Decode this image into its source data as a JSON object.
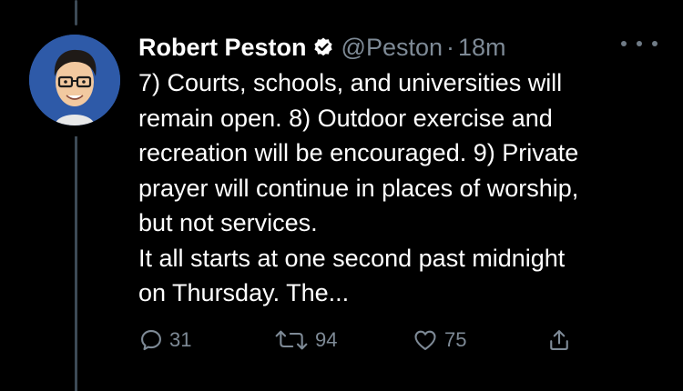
{
  "tweet": {
    "author_name": "Robert Peston",
    "handle": "@Peston",
    "separator": "·",
    "time": "18m",
    "body": "7) Courts, schools, and universities will\nremain open. 8) Outdoor exercise and\nrecreation will be encouraged. 9) Private\nprayer will continue in places of worship,\nbut not services.\nIt all starts at one second past midnight\non Thursday. The...",
    "verified": true
  },
  "actions": {
    "reply_count": "31",
    "retweet_count": "94",
    "like_count": "75"
  },
  "icons": {
    "verified": "verified-badge-icon",
    "more": "more-icon",
    "reply": "reply-icon",
    "retweet": "retweet-icon",
    "like": "like-icon",
    "share": "share-icon"
  },
  "colors": {
    "background": "#000000",
    "text": "#ffffff",
    "secondary_text": "#7e8a96",
    "avatar_bg": "#2e5aa8"
  }
}
